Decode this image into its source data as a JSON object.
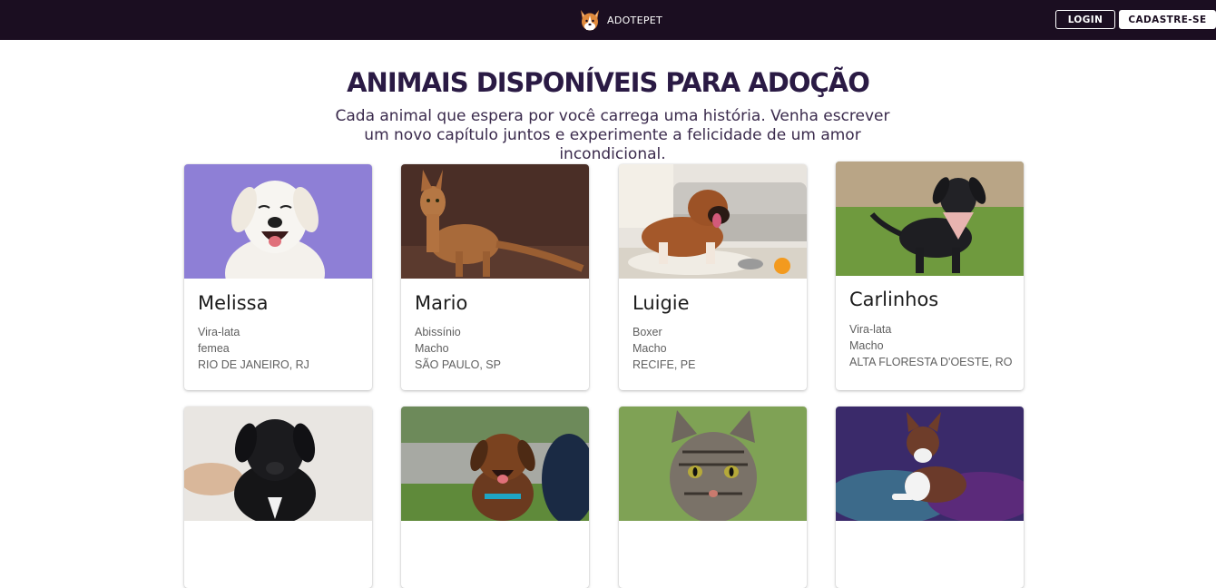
{
  "header": {
    "brand": "ADOTEPET",
    "login_label": "LOGIN",
    "signup_label": "CADASTRE-SE"
  },
  "main": {
    "title": "ANIMAIS DISPONÍVEIS PARA ADOÇÃO",
    "subtitle": "Cada animal que espera por você carrega uma história. Venha escrever um novo capítulo juntos e experimente a felicidade de um amor incondicional."
  },
  "animals": [
    {
      "name": "Melissa",
      "breed": "Vira-lata",
      "sex": "femea",
      "location": "RIO DE JANEIRO, RJ"
    },
    {
      "name": "Mario",
      "breed": "Abissínio",
      "sex": "Macho",
      "location": "SÃO PAULO, SP"
    },
    {
      "name": "Luigie",
      "breed": "Boxer",
      "sex": "Macho",
      "location": "RECIFE, PE"
    },
    {
      "name": "Carlinhos",
      "breed": "Vira-lata",
      "sex": "Macho",
      "location": "ALTA FLORESTA D'OESTE, RO"
    },
    {
      "name": "",
      "breed": "",
      "sex": "",
      "location": ""
    },
    {
      "name": "",
      "breed": "",
      "sex": "",
      "location": ""
    },
    {
      "name": "",
      "breed": "",
      "sex": "",
      "location": ""
    },
    {
      "name": "",
      "breed": "",
      "sex": "",
      "location": ""
    }
  ]
}
